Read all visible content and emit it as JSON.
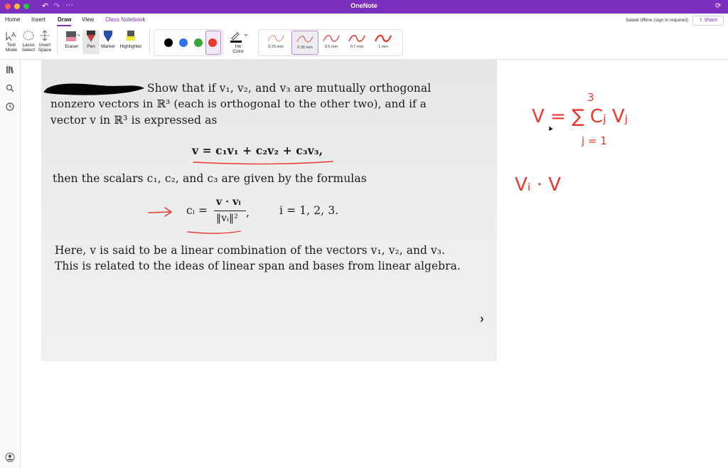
{
  "window": {
    "title": "OneNote",
    "traffic_colors": [
      "#ff5f57",
      "#febc2e",
      "#28c840"
    ]
  },
  "menu": {
    "items": [
      "Home",
      "Insert",
      "Draw",
      "View",
      "Class Notebook"
    ],
    "active": "Draw",
    "saved_status": "Saved offline (sign in required)",
    "share_label": "Share"
  },
  "ribbon": {
    "text_mode": "Text\nMode",
    "lasso": "Lasso\nSelect",
    "insert_space": "Insert\nSpace",
    "eraser": "Eraser",
    "pen": "Pen",
    "marker": "Marker",
    "highlighter": "Highlighter",
    "ink_color": "Ink\nColor",
    "colors": [
      "#000000",
      "#2f6fe8",
      "#3aa33a",
      "#e8392e"
    ],
    "selected_color": "#e8392e",
    "thicknesses": [
      "0.25 mm",
      "0.35 mm",
      "0.5 mm",
      "0.7 mm",
      "1 mm"
    ],
    "selected_thickness": "0.35 mm"
  },
  "sidebar": {
    "icons": [
      "notebooks-icon",
      "search-icon",
      "recent-icon"
    ]
  },
  "scan": {
    "line1": "Show that if v₁, v₂, and v₃ are mutually orthogonal",
    "line2": "nonzero vectors in ℝ³ (each is orthogonal to the other two), and if a",
    "line3": "vector v in ℝ³ is expressed as",
    "eq1": "v = c₁v₁ + c₂v₂ + c₃v₃,",
    "line4": "then the scalars c₁, c₂, and c₃ are given by the formulas",
    "eq2_lhs": "cᵢ =",
    "eq2_num": "v · vᵢ",
    "eq2_den": "‖vᵢ‖²",
    "eq2_comma": ",",
    "eq2_range": "i = 1, 2, 3.",
    "line5": "Here, v is said to be a linear combination of the vectors v₁, v₂, and v₃.",
    "line6": "This is related to the ideas of linear span and bases from linear algebra."
  },
  "ink": {
    "color": "#e8392e",
    "note1": "V = ∑ Cⱼ Vⱼ",
    "note1_upper": "3",
    "note1_lower": "j = 1",
    "note2": "Vᵢ · V"
  }
}
